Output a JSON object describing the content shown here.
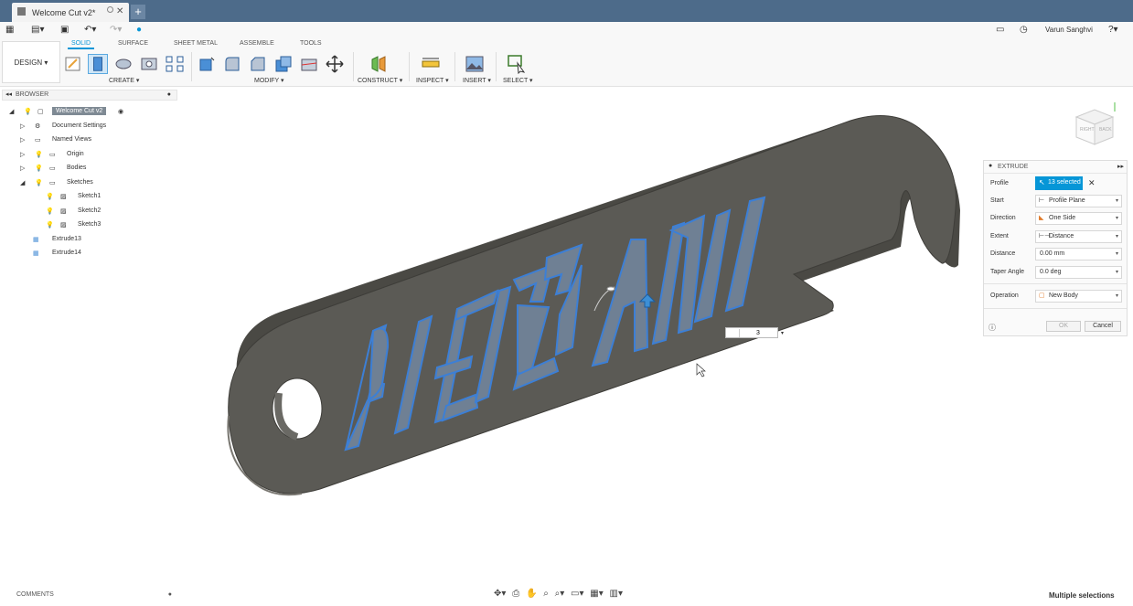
{
  "tab": {
    "title": "Welcome Cut v2*"
  },
  "user": {
    "name": "Varun Sanghvi"
  },
  "ribbon": {
    "workspace": "DESIGN",
    "tabs": [
      "SOLID",
      "SURFACE",
      "SHEET METAL",
      "ASSEMBLE",
      "TOOLS"
    ],
    "groups": [
      "CREATE",
      "MODIFY",
      "CONSTRUCT",
      "INSPECT",
      "INSERT",
      "SELECT"
    ]
  },
  "browser": {
    "title": "BROWSER",
    "root": "Welcome Cut v2",
    "items": [
      "Document Settings",
      "Named Views",
      "Origin",
      "Bodies",
      "Sketches",
      "Sketch1",
      "Sketch2",
      "Sketch3",
      "Extrude13",
      "Extrude14"
    ]
  },
  "comments": {
    "label": "COMMENTS"
  },
  "status": {
    "text": "Multiple selections"
  },
  "viewcube": {
    "right": "RIGHT",
    "back": "BACK"
  },
  "extrude": {
    "title": "EXTRUDE",
    "rows": {
      "profile": {
        "label": "Profile",
        "value": "13 selected"
      },
      "start": {
        "label": "Start",
        "value": "Profile Plane"
      },
      "direction": {
        "label": "Direction",
        "value": "One Side"
      },
      "extent": {
        "label": "Extent",
        "value": "Distance"
      },
      "distance": {
        "label": "Distance",
        "value": "0.00 mm"
      },
      "taper": {
        "label": "Taper Angle",
        "value": "0.0 deg"
      },
      "operation": {
        "label": "Operation",
        "value": "New Body"
      }
    },
    "ok": "OK",
    "cancel": "Cancel"
  },
  "canvas_input": {
    "value": "3"
  },
  "colors": {
    "accent": "#0696d7",
    "titlebar": "#4d6b8a",
    "body": "#5b5a55",
    "profile_fill": "#6f8094",
    "profile_edge": "#3c7fd6"
  }
}
